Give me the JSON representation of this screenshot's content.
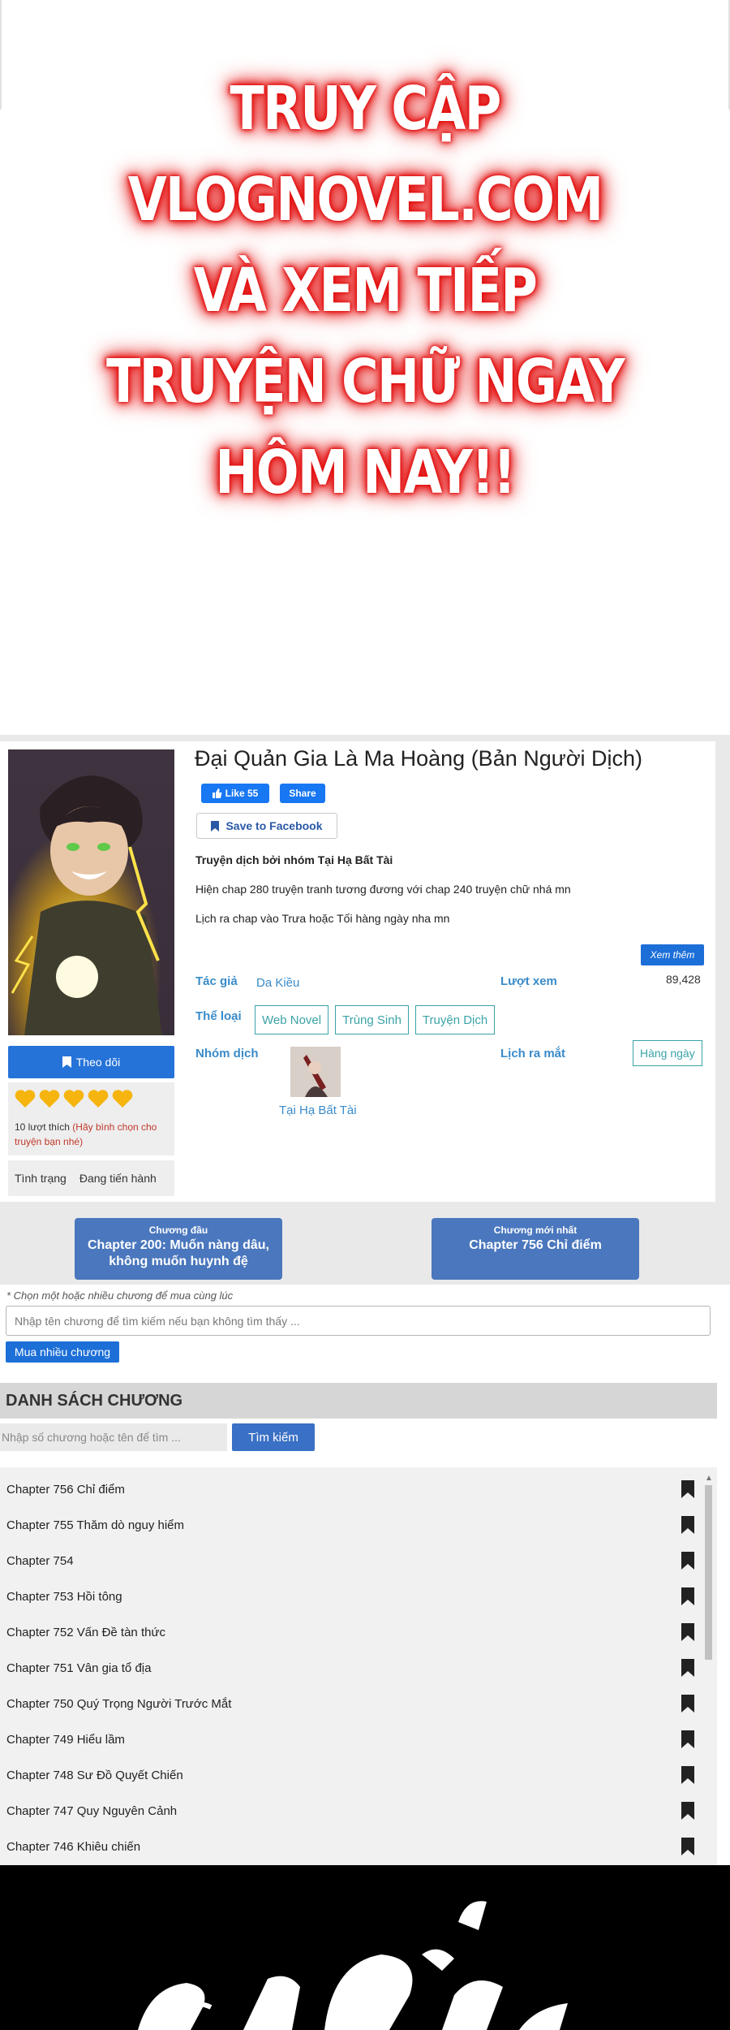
{
  "banner": {
    "lines": [
      "TRUY CẬP",
      "VLOGNOVEL.COM",
      "VÀ XEM TIẾP",
      "TRUYỆN CHỮ NGAY",
      "HÔM NAY!!"
    ]
  },
  "manga": {
    "title": "Đại Quản Gia Là Ma Hoàng (Bản Người Dịch)",
    "like_label": "Like 55",
    "share_label": "Share",
    "save_label": "Save to Facebook",
    "desc_1": "Truyện dịch bởi nhóm Tại Hạ Bất Tài",
    "desc_2": "Hiện chap 280 truyện tranh tương đương với chap 240 truyện chữ nhá mn",
    "desc_3": "Lịch ra chap vào Trưa hoặc Tối hàng ngày nha mn",
    "more_label": "Xem thêm",
    "author_label": "Tác giả",
    "author": "Da Kiều",
    "views_label": "Lượt xem",
    "views": "89,428",
    "genre_label": "Thể loại",
    "genres": [
      "Web Novel",
      "Trùng Sinh",
      "Truyện Dịch"
    ],
    "group_label": "Nhóm dịch",
    "group_name": "Tại Hạ Bất Tài",
    "schedule_label": "Lịch ra mắt",
    "schedule": "Hàng ngày",
    "follow_label": "Theo dõi",
    "likes_count": "10 lượt thích",
    "likes_hint": "(Hãy bình chọn cho truyện bạn nhé)",
    "status_label": "Tình trạng",
    "status_value": "Đang tiến hành",
    "heart_color": "#f6b40e"
  },
  "chapter_nav": {
    "first_small": "Chương đầu",
    "first_big": "Chapter 200: Muốn nàng dâu, không muốn huynh đệ",
    "latest_small": "Chương mới nhất",
    "latest_big": "Chapter 756 Chỉ điểm"
  },
  "buy": {
    "note": "* Chọn một hoặc nhiều chương để mua cùng lúc",
    "placeholder": "Nhập tên chương để tìm kiếm nếu bạn không tìm thấy ...",
    "button": "Mua nhiều chương"
  },
  "chapter_list": {
    "header": "DANH SÁCH CHƯƠNG",
    "search_placeholder": "Nhập số chương hoặc tên để tìm ...",
    "search_button": "Tìm kiếm",
    "chapters": [
      "Chapter 756 Chỉ điểm",
      "Chapter 755 Thăm dò nguy hiểm",
      "Chapter 754",
      "Chapter 753 Hồi tông",
      "Chapter 752 Vấn Đề tàn thức",
      "Chapter 751 Vân gia tổ địa",
      "Chapter 750 Quý Trọng Người Trước Mắt",
      "Chapter 749 Hiểu lầm",
      "Chapter 748 Sư Đồ Quyết Chiến",
      "Chapter 747 Quy Nguyên Cảnh",
      "Chapter 746 Khiêu chiến"
    ]
  },
  "colors": {
    "primary_blue": "#2573d9",
    "teal": "#3aa3a8",
    "link_blue": "#3a8bc9",
    "banner_glow": "#e00d0d"
  }
}
